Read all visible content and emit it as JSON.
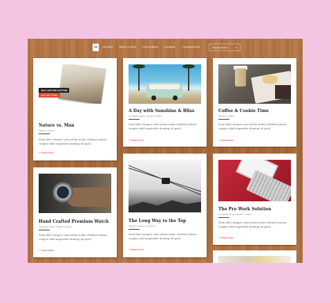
{
  "filters": {
    "all": "All",
    "items": [
      "Just Next",
      "Hipster Content",
      "General News",
      "Computer",
      "Company News"
    ],
    "sort_label": "Sort By Name",
    "sort_caret": "▾"
  },
  "cards": [
    {
      "title": "Nature vs. Man",
      "meta": "Hipster Content",
      "caption": "I'M A CUSTOM CAPTION",
      "caption_sub": "ADD ANYTHING",
      "excerpt": "Nam liber tempor cum soluta nobis eleifend option congue nihil imperdiet doming id quod...",
      "more": "+ Read More"
    },
    {
      "title": "A Day with Sunshine & Bliss",
      "meta": "In Popular News, Hipster Content",
      "excerpt": "Nam liber tempor cum soluta nobis eleifend option congue nihil imperdiet doming id quod...",
      "more": "+ Read More"
    },
    {
      "title": "Coffee & Cookie Time",
      "meta": "Hipster Content",
      "excerpt": "Nam liber tempor cum soluta nobis eleifend option congue nihil imperdiet doming id quod...",
      "more": "+ Read More"
    },
    {
      "title": "Hand Crafted Premium Watch",
      "meta": "Company News, Hipster Content",
      "excerpt": "Nam liber tempor cum soluta nobis eleifend option congue nihil imperdiet doming id quod...",
      "more": "+ Read More"
    },
    {
      "title": "The Long Way to the Top",
      "meta": "Hipster Content, Just Next",
      "excerpt": "Nam liber tempor cum soluta nobis eleifend option congue nihil imperdiet doming id quod...",
      "more": "+ Read More"
    },
    {
      "title": "The Pro Work Solution",
      "meta": "Company News, Hipster Content",
      "excerpt": "Nam liber tempor cum soluta nobis eleifend option congue nihil imperdiet doming id quod...",
      "more": "+ Read More"
    }
  ]
}
